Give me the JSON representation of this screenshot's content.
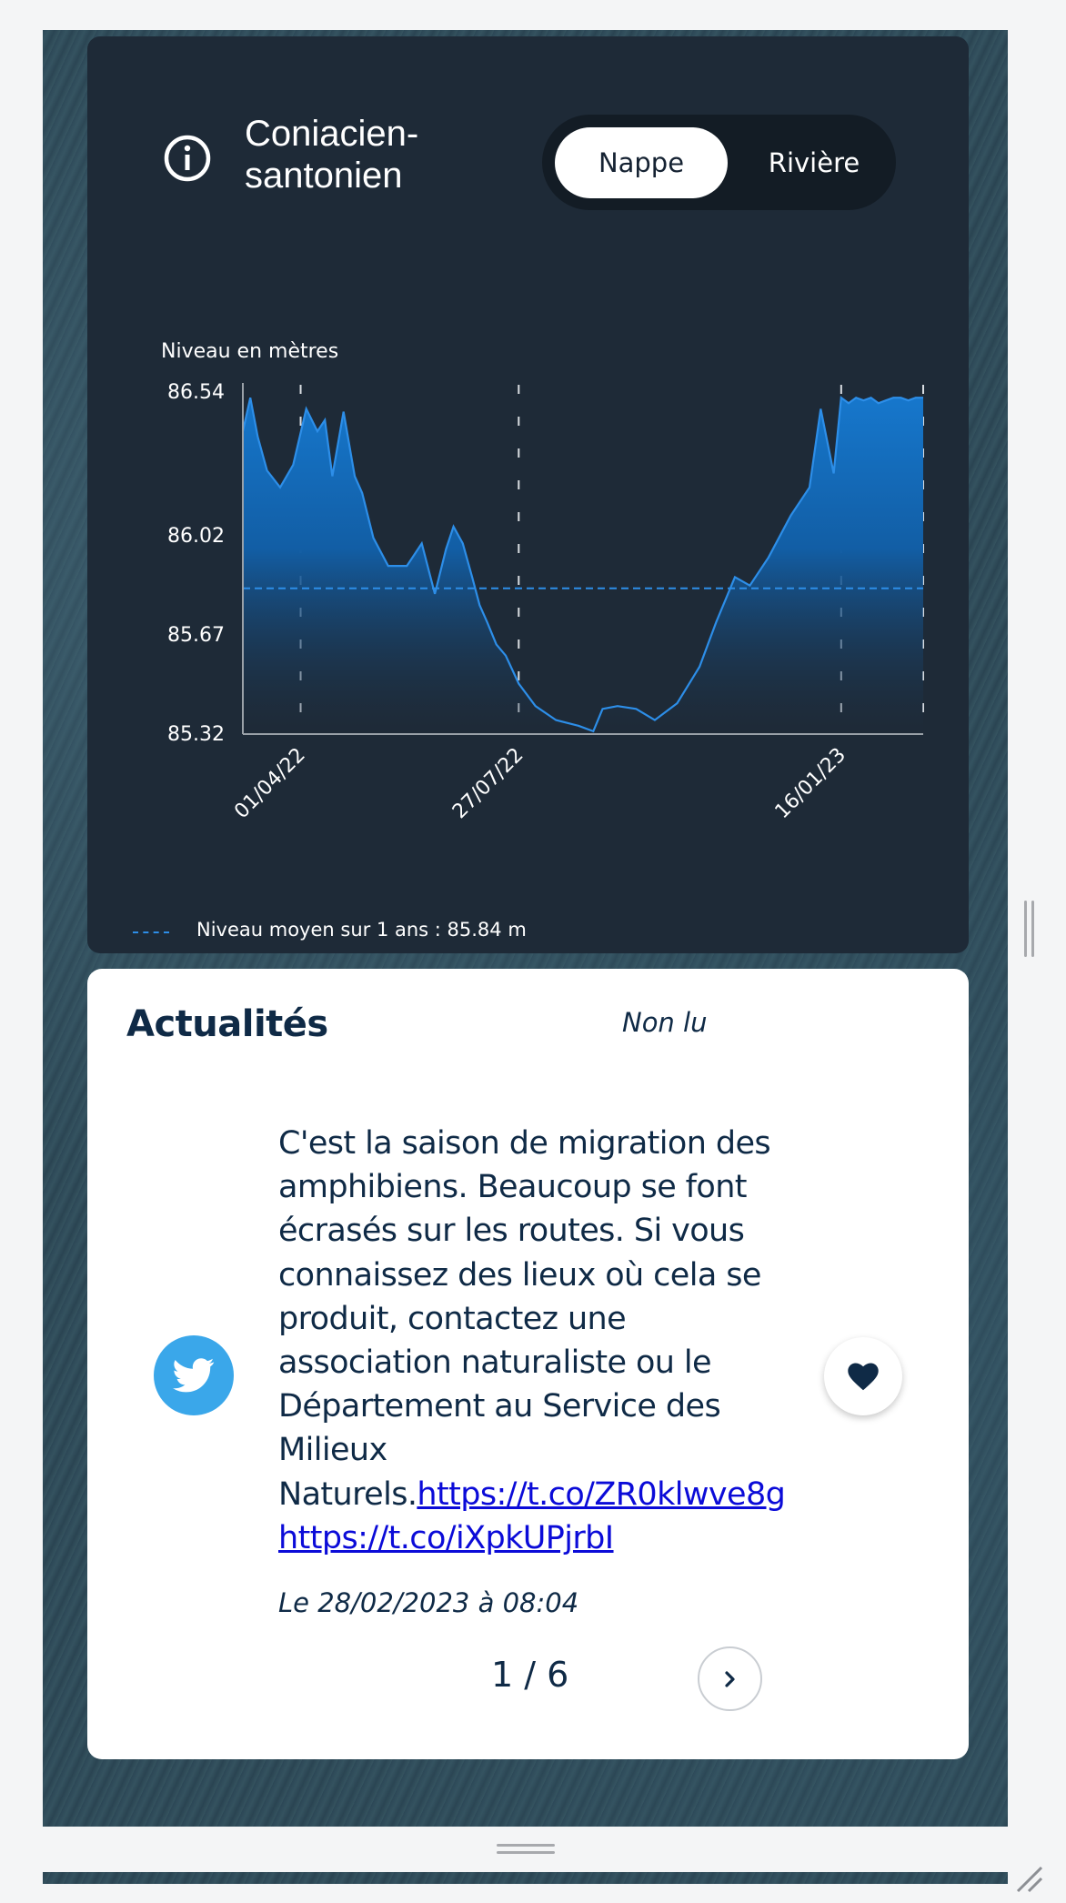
{
  "aquifer": {
    "title_line1": "Coniacien-",
    "title_line2": "santonien",
    "icon": "info-icon"
  },
  "toggle": {
    "options": [
      "Nappe",
      "Rivière"
    ],
    "selected": "Nappe"
  },
  "chart_data": {
    "type": "area",
    "ylabel": "Niveau en mètres",
    "yticks": [
      "86.54",
      "86.02",
      "85.67",
      "85.32"
    ],
    "ytick_values": [
      86.54,
      86.02,
      85.67,
      85.32
    ],
    "ylim": [
      85.32,
      86.54
    ],
    "xticks": [
      "01/04/22",
      "27/07/22",
      "16/01/23"
    ],
    "x_range": [
      "2022-03-01",
      "2023-03-01"
    ],
    "mean_line": 85.84,
    "legend": "Niveau moyen sur 1 ans : 85.84 m",
    "legend_position": "bottom-left",
    "grid": "vertical dashed at x ticks",
    "series_color": "#2d8ee8",
    "series": [
      {
        "x": [
          "2022-03-01",
          "2022-03-05",
          "2022-03-09",
          "2022-03-14",
          "2022-03-21",
          "2022-03-28",
          "2022-04-04",
          "2022-04-10",
          "2022-04-14",
          "2022-04-18",
          "2022-04-24",
          "2022-04-30",
          "2022-05-04",
          "2022-05-10",
          "2022-05-18",
          "2022-05-28",
          "2022-06-05",
          "2022-06-12",
          "2022-06-18",
          "2022-06-22",
          "2022-06-27",
          "2022-07-02",
          "2022-07-06",
          "2022-07-10",
          "2022-07-15",
          "2022-07-20",
          "2022-07-27",
          "2022-08-05",
          "2022-08-16",
          "2022-08-28",
          "2022-09-05",
          "2022-09-10",
          "2022-09-18",
          "2022-09-28",
          "2022-10-08",
          "2022-10-20",
          "2022-11-01",
          "2022-11-10",
          "2022-11-20",
          "2022-11-28",
          "2022-12-08",
          "2022-12-20",
          "2022-12-30",
          "2023-01-05",
          "2023-01-12",
          "2023-01-16",
          "2023-01-20",
          "2023-01-24",
          "2023-01-28",
          "2023-02-01",
          "2023-02-05",
          "2023-02-09",
          "2023-02-13",
          "2023-02-17",
          "2023-02-21",
          "2023-02-25",
          "2023-03-01"
        ],
        "y": [
          86.4,
          86.52,
          86.38,
          86.26,
          86.2,
          86.28,
          86.48,
          86.4,
          86.44,
          86.24,
          86.47,
          86.24,
          86.18,
          86.02,
          85.92,
          85.92,
          86.0,
          85.82,
          85.98,
          86.06,
          86.0,
          85.88,
          85.78,
          85.72,
          85.64,
          85.6,
          85.5,
          85.42,
          85.37,
          85.35,
          85.33,
          85.41,
          85.42,
          85.41,
          85.37,
          85.43,
          85.56,
          85.72,
          85.88,
          85.85,
          85.95,
          86.1,
          86.2,
          86.48,
          86.25,
          86.52,
          86.5,
          86.52,
          86.51,
          86.52,
          86.5,
          86.51,
          86.52,
          86.52,
          86.51,
          86.52,
          86.52
        ]
      }
    ]
  },
  "news": {
    "title": "Actualités",
    "filter": "Non lu",
    "source_icon": "twitter-icon",
    "text": "C'est la saison de migration des amphibiens. Beaucoup se font écrasés sur les routes. Si vous connaissez des lieux où cela se produit, contactez une association naturaliste ou le Département au Service des Milieux Naturels.",
    "link1": "https://t.co/ZR0klwve8g",
    "link2": "https://t.co/iXpkUPjrbI",
    "date": "Le 28/02/2023 à 08:04",
    "pager": "1 / 6",
    "like_icon": "heart-icon",
    "next_icon": "chevron-right-icon"
  }
}
